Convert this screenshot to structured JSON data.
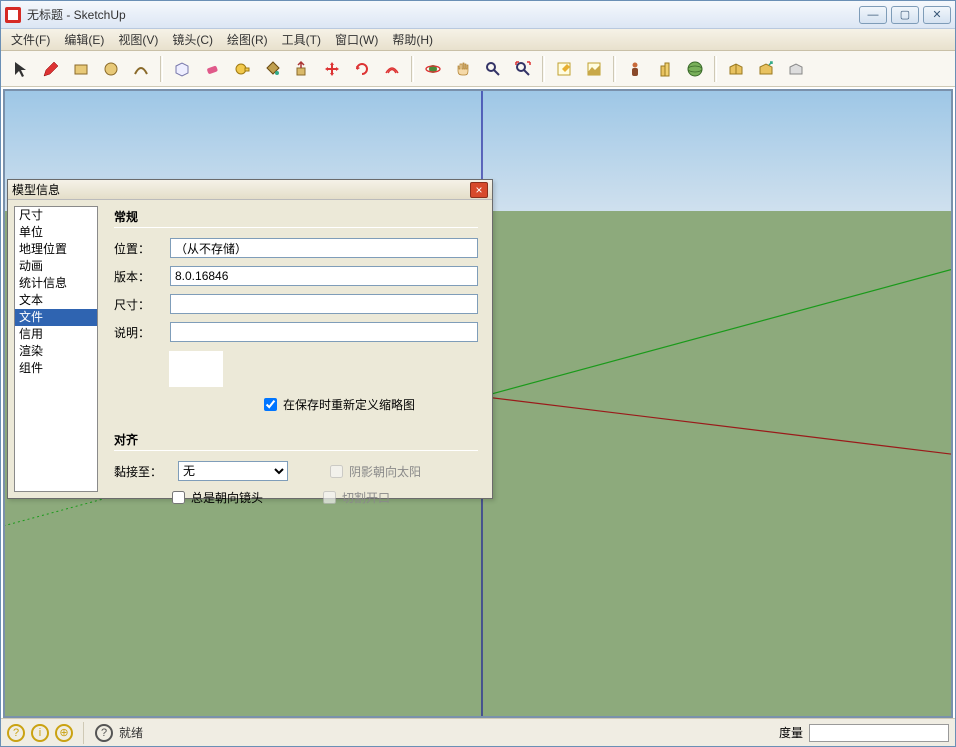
{
  "titlebar": {
    "title": "无标题 - SketchUp"
  },
  "menubar": {
    "items": [
      "文件(F)",
      "编辑(E)",
      "视图(V)",
      "镜头(C)",
      "绘图(R)",
      "工具(T)",
      "窗口(W)",
      "帮助(H)"
    ]
  },
  "toolbar": {
    "buttons": [
      "select-icon",
      "pencil-icon",
      "rectangle-icon",
      "circle-icon",
      "arc-icon",
      "sep",
      "eraser-icon",
      "paintbucket-icon",
      "tape-icon",
      "pushpull-icon",
      "offset-icon",
      "move-icon",
      "rotate-icon",
      "followme-icon",
      "scale-icon",
      "sep",
      "orbit-icon",
      "pan-icon",
      "zoom-icon",
      "zoom-extents-icon",
      "sep",
      "add-location-icon",
      "terrain-icon",
      "photo-icon",
      "texture-icon",
      "3dwarehouse-icon",
      "upload-icon",
      "get-models-icon",
      "share-icon",
      "model-info-icon"
    ]
  },
  "dialog": {
    "title": "模型信息",
    "categories": [
      "尺寸",
      "单位",
      "地理位置",
      "动画",
      "统计信息",
      "文本",
      "文件",
      "信用",
      "渲染",
      "组件"
    ],
    "selected": "文件",
    "general": {
      "heading": "常规",
      "labels": {
        "location": "位置：",
        "version": "版本：",
        "size": "尺寸：",
        "description": "说明："
      },
      "location": "（从不存储）",
      "version": "8.0.16846",
      "size": "",
      "description": "",
      "redefine_thumb_label": "在保存时重新定义缩略图",
      "redefine_thumb_checked": true
    },
    "align": {
      "heading": "对齐",
      "glue_label": "黏接至：",
      "glue_value": "无",
      "always_face_camera": "总是朝向镜头",
      "shadows_face_sun": "阴影朝向太阳",
      "cut_opening": "切割开口"
    }
  },
  "statusbar": {
    "ready": "就绪",
    "measure_label": "度量"
  }
}
